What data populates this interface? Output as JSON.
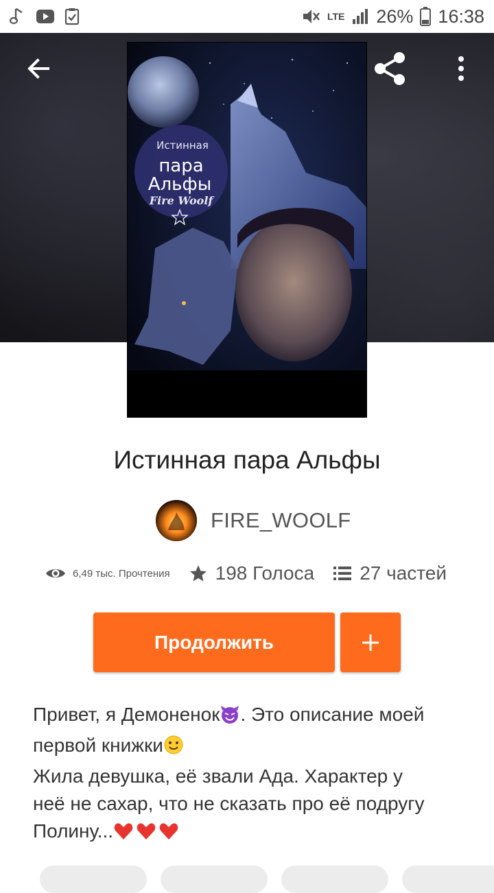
{
  "status_bar": {
    "battery": "26%",
    "time": "16:38",
    "network": "LTE"
  },
  "story": {
    "title": "Истинная пара Альфы",
    "author": "FIRE_WOOLF",
    "cover": {
      "line1": "Истинная",
      "line2": "пара",
      "line3": "Альфы",
      "signature": "Fire Woolf"
    }
  },
  "stats": {
    "reads": "6,49 тыс. Прочтения",
    "votes": "198 Голоса",
    "parts": "27 частей"
  },
  "actions": {
    "continue_label": "Продолжить",
    "add_label": "+"
  },
  "description": {
    "line1": "Привет, я Демоненок",
    "line1b": ". Это описание моей",
    "line2": "первой книжки",
    "line3": "Жила девушка, её звали Ада. Характер у",
    "line4": "неё не сахар, что не сказать про её подругу",
    "line5": "Полину..."
  },
  "colors": {
    "accent": "#ff6b1c",
    "text": "#222222",
    "muted": "#555555"
  },
  "icons": {
    "back": "arrow-left",
    "share": "share",
    "more": "more-vertical",
    "reads": "eye",
    "votes": "star",
    "parts": "list"
  }
}
